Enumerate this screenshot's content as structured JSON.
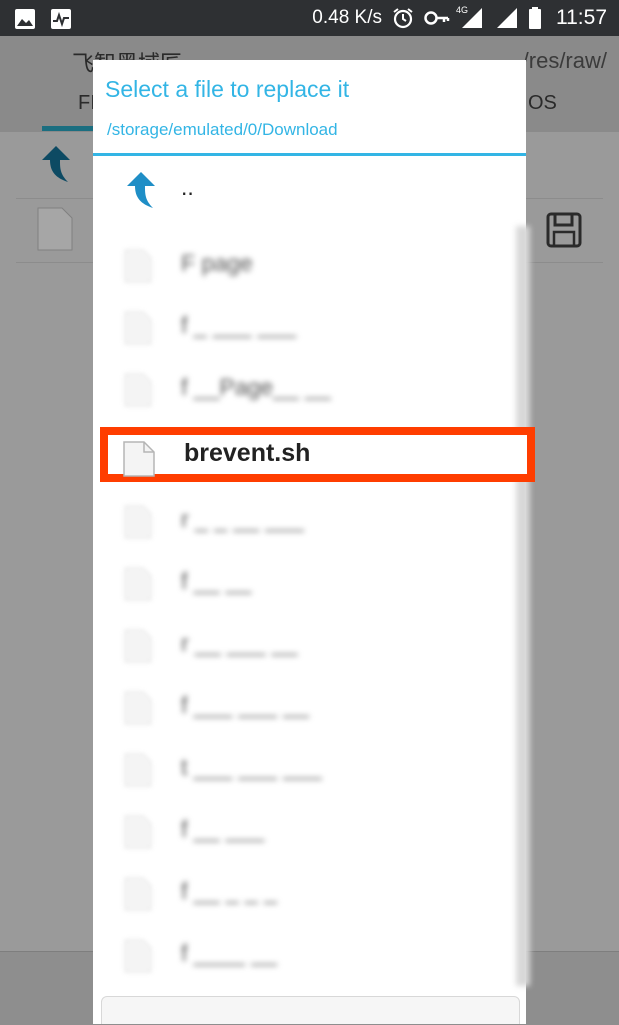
{
  "status_bar": {
    "net_speed": "0.48 K/s",
    "network_type": "4G",
    "time": "11:57",
    "icons": [
      "image-icon",
      "activity-icon",
      "alarm-icon",
      "key-icon",
      "signal-icon",
      "signal-icon",
      "battery-icon"
    ]
  },
  "background_app": {
    "title": "飞智黑域匠",
    "path": "/res/raw/",
    "tab_left": "FI",
    "tab_right": "OS"
  },
  "dialog": {
    "title": "Select a file to replace it",
    "path": "/storage/emulated/0/Download",
    "parent_label": "..",
    "selected_file": "brevent.sh",
    "blurred_items": [
      "F  page",
      "f  _  ___  ___",
      "f  __Page__  __",
      "r  _  _  __  ___",
      "f  __  __",
      "r  __  ___  __",
      "f  ___  ___  __",
      "t  ___  ___  ___",
      "f  __  ___",
      "f  __  _  _  _",
      "f  ____  __"
    ]
  },
  "colors": {
    "accent": "#33b5e5",
    "highlight": "#ff3d00",
    "statusbar": "#2e3033"
  }
}
